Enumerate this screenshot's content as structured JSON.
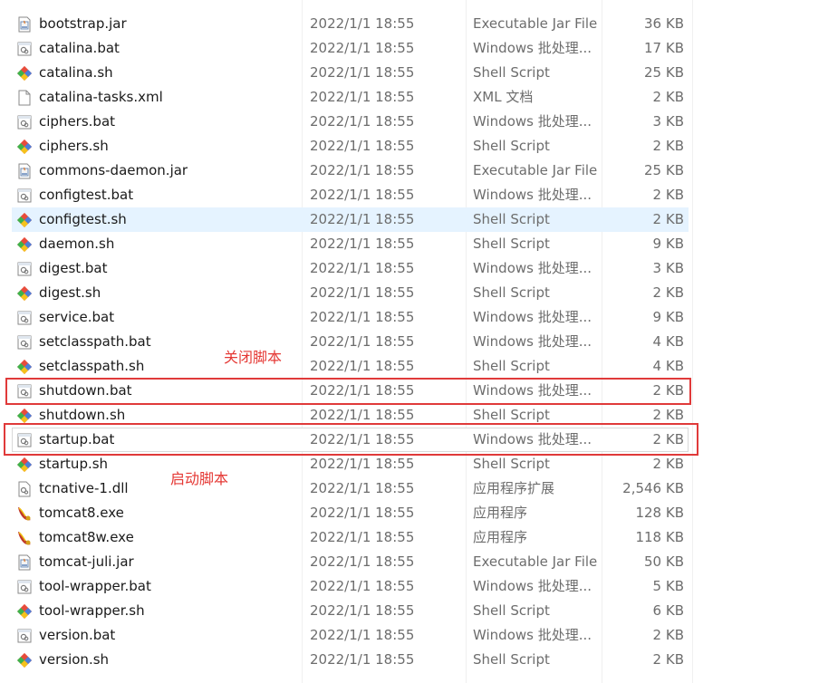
{
  "files": [
    {
      "name": "bootstrap.jar",
      "date": "2022/1/1 18:55",
      "type": "Executable Jar File",
      "size": "36 KB",
      "icon": "jar-icon"
    },
    {
      "name": "catalina.bat",
      "date": "2022/1/1 18:55",
      "type": "Windows 批处理...",
      "size": "17 KB",
      "icon": "bat-icon"
    },
    {
      "name": "catalina.sh",
      "date": "2022/1/1 18:55",
      "type": "Shell Script",
      "size": "25 KB",
      "icon": "sh-icon"
    },
    {
      "name": "catalina-tasks.xml",
      "date": "2022/1/1 18:55",
      "type": "XML 文档",
      "size": "2 KB",
      "icon": "xml-icon"
    },
    {
      "name": "ciphers.bat",
      "date": "2022/1/1 18:55",
      "type": "Windows 批处理...",
      "size": "3 KB",
      "icon": "bat-icon"
    },
    {
      "name": "ciphers.sh",
      "date": "2022/1/1 18:55",
      "type": "Shell Script",
      "size": "2 KB",
      "icon": "sh-icon"
    },
    {
      "name": "commons-daemon.jar",
      "date": "2022/1/1 18:55",
      "type": "Executable Jar File",
      "size": "25 KB",
      "icon": "jar-icon"
    },
    {
      "name": "configtest.bat",
      "date": "2022/1/1 18:55",
      "type": "Windows 批处理...",
      "size": "2 KB",
      "icon": "bat-icon"
    },
    {
      "name": "configtest.sh",
      "date": "2022/1/1 18:55",
      "type": "Shell Script",
      "size": "2 KB",
      "icon": "sh-icon"
    },
    {
      "name": "daemon.sh",
      "date": "2022/1/1 18:55",
      "type": "Shell Script",
      "size": "9 KB",
      "icon": "sh-icon"
    },
    {
      "name": "digest.bat",
      "date": "2022/1/1 18:55",
      "type": "Windows 批处理...",
      "size": "3 KB",
      "icon": "bat-icon"
    },
    {
      "name": "digest.sh",
      "date": "2022/1/1 18:55",
      "type": "Shell Script",
      "size": "2 KB",
      "icon": "sh-icon"
    },
    {
      "name": "service.bat",
      "date": "2022/1/1 18:55",
      "type": "Windows 批处理...",
      "size": "9 KB",
      "icon": "bat-icon"
    },
    {
      "name": "setclasspath.bat",
      "date": "2022/1/1 18:55",
      "type": "Windows 批处理...",
      "size": "4 KB",
      "icon": "bat-icon"
    },
    {
      "name": "setclasspath.sh",
      "date": "2022/1/1 18:55",
      "type": "Shell Script",
      "size": "4 KB",
      "icon": "sh-icon"
    },
    {
      "name": "shutdown.bat",
      "date": "2022/1/1 18:55",
      "type": "Windows 批处理...",
      "size": "2 KB",
      "icon": "bat-icon"
    },
    {
      "name": "shutdown.sh",
      "date": "2022/1/1 18:55",
      "type": "Shell Script",
      "size": "2 KB",
      "icon": "sh-icon"
    },
    {
      "name": "startup.bat",
      "date": "2022/1/1 18:55",
      "type": "Windows 批处理...",
      "size": "2 KB",
      "icon": "bat-icon"
    },
    {
      "name": "startup.sh",
      "date": "2022/1/1 18:55",
      "type": "Shell Script",
      "size": "2 KB",
      "icon": "sh-icon"
    },
    {
      "name": "tcnative-1.dll",
      "date": "2022/1/1 18:55",
      "type": "应用程序扩展",
      "size": "2,546 KB",
      "icon": "dll-icon"
    },
    {
      "name": "tomcat8.exe",
      "date": "2022/1/1 18:55",
      "type": "应用程序",
      "size": "128 KB",
      "icon": "tomcat-exe-icon"
    },
    {
      "name": "tomcat8w.exe",
      "date": "2022/1/1 18:55",
      "type": "应用程序",
      "size": "118 KB",
      "icon": "tomcat-exe-icon"
    },
    {
      "name": "tomcat-juli.jar",
      "date": "2022/1/1 18:55",
      "type": "Executable Jar File",
      "size": "50 KB",
      "icon": "jar-icon"
    },
    {
      "name": "tool-wrapper.bat",
      "date": "2022/1/1 18:55",
      "type": "Windows 批处理...",
      "size": "5 KB",
      "icon": "bat-icon"
    },
    {
      "name": "tool-wrapper.sh",
      "date": "2022/1/1 18:55",
      "type": "Shell Script",
      "size": "6 KB",
      "icon": "sh-icon"
    },
    {
      "name": "version.bat",
      "date": "2022/1/1 18:55",
      "type": "Windows 批处理...",
      "size": "2 KB",
      "icon": "bat-icon"
    },
    {
      "name": "version.sh",
      "date": "2022/1/1 18:55",
      "type": "Shell Script",
      "size": "2 KB",
      "icon": "sh-icon"
    }
  ],
  "state": {
    "hovered_file": "configtest.sh",
    "focused_file": "startup.bat"
  },
  "annotations": {
    "shutdown_label": "关闭脚本",
    "startup_label": "启动脚本",
    "color": "#e53935"
  }
}
